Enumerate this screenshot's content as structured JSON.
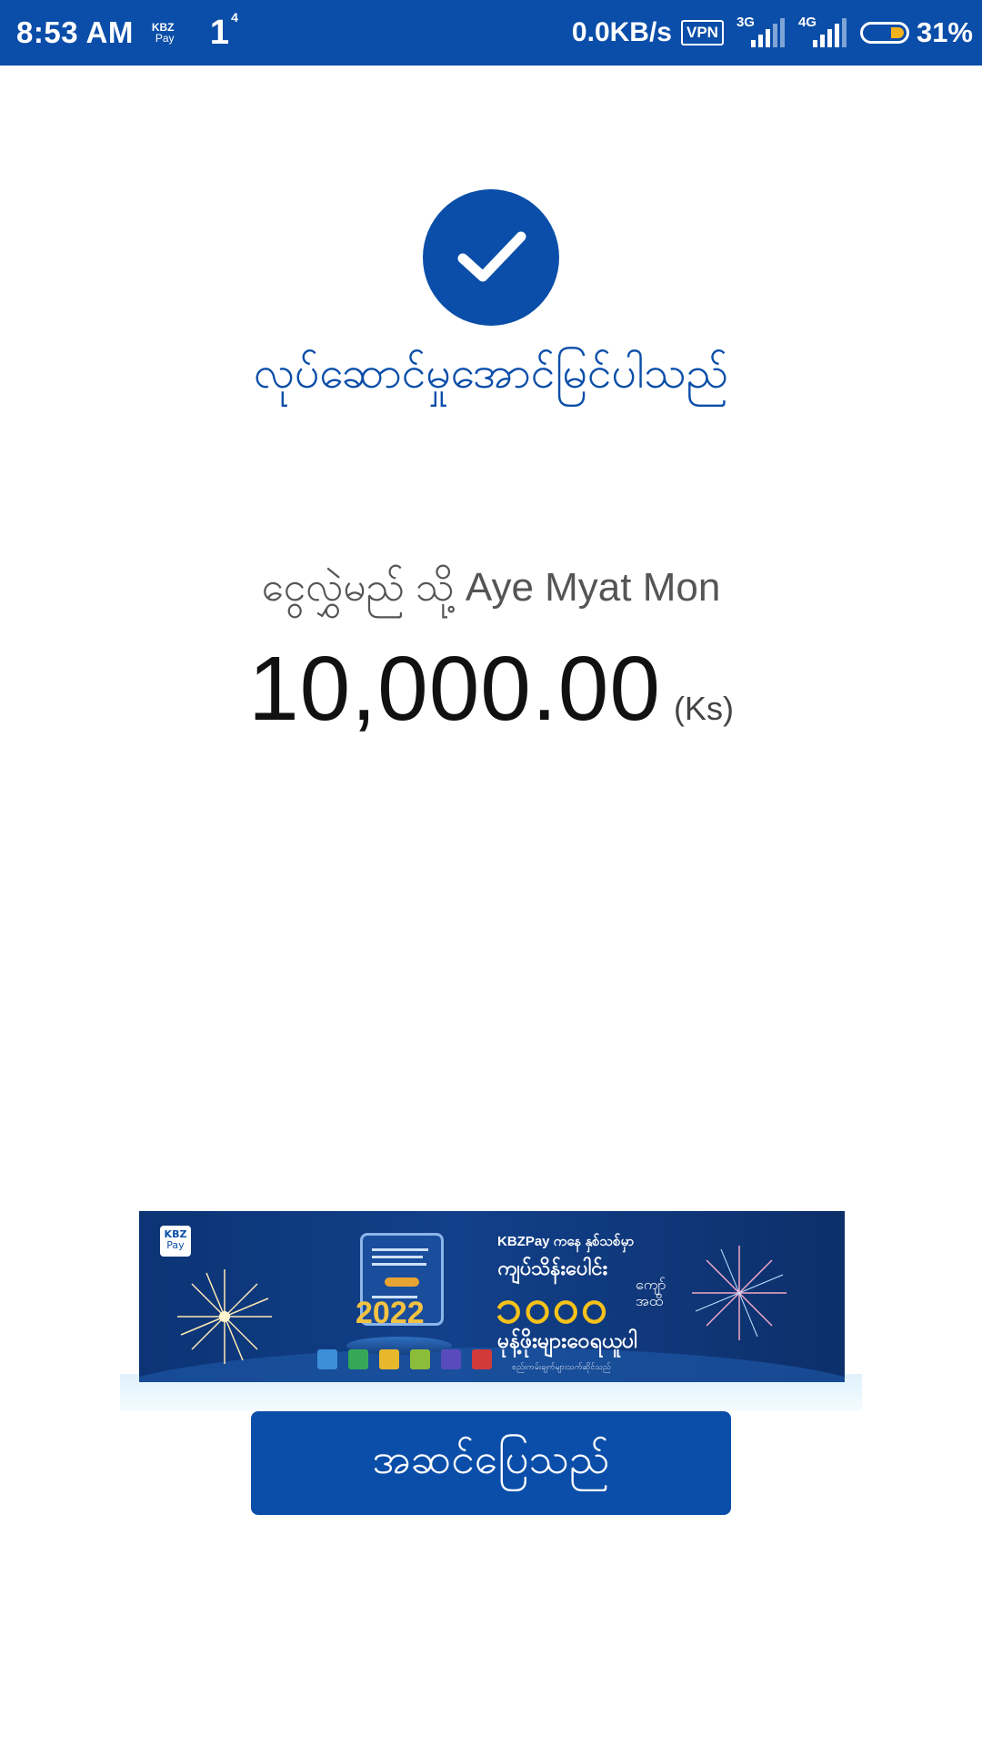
{
  "status_bar": {
    "time": "8:53 AM",
    "app_badge_top": "KBZ",
    "app_badge_bottom": "Pay",
    "notification_count": "1",
    "notification_sup": "4",
    "net_speed": "0.0KB/s",
    "vpn_label": "VPN",
    "sim1_network": "3G",
    "sim2_network": "4G",
    "battery_percent": "31%",
    "battery_level": 0.31,
    "colors": {
      "bar": "#0b4ea9",
      "battery_fill": "#f1b21c"
    }
  },
  "result": {
    "icon": "checkmark-icon",
    "title": "လုပ်ဆောင်မှုအောင်မြင်ပါသည်",
    "recipient_prefix": "ငွေလွှဲမည် သို့",
    "recipient_name": "Aye Myat Mon",
    "amount": "10,000.00",
    "currency": "(Ks)"
  },
  "banner": {
    "logo_top": "KBZ",
    "logo_bottom": "Pay",
    "heading": "KBZPay ကနေ နှစ်သစ်မှာ",
    "line1": "ကျပ်သိန်းပေါင်း",
    "amount": "၁၀၀၀",
    "amount_unit_top": "ကျော်",
    "amount_unit_bottom": "အထိ",
    "line3": "မုန့်ဖိုးများဝေရယူပါ",
    "fine_print": "စည်းကမ်းချက်များသက်ဆိုင်သည်",
    "year": "2022"
  },
  "done_button": {
    "label": "အဆင်ပြေသည်"
  },
  "colors": {
    "accent": "#0b4ea9",
    "banner_gold": "#f6c21a"
  }
}
